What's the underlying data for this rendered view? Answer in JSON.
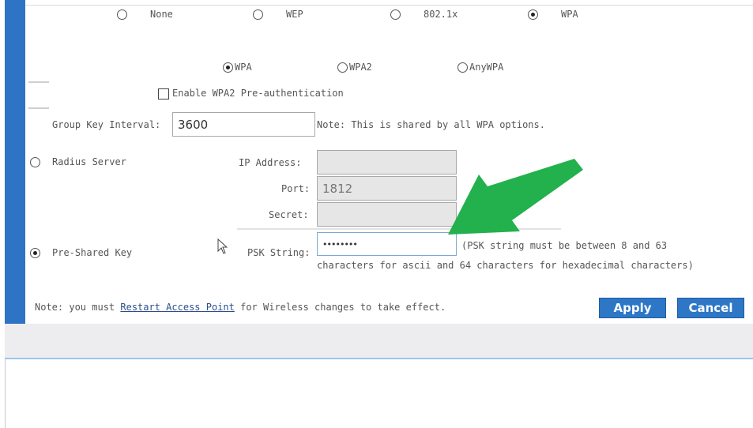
{
  "security_mode": {
    "options": [
      {
        "label": "None",
        "checked": false
      },
      {
        "label": "WEP",
        "checked": false
      },
      {
        "label": "802.1x",
        "checked": false
      },
      {
        "label": "WPA",
        "checked": true
      }
    ]
  },
  "wpa_version": {
    "options": [
      {
        "label": "WPA",
        "checked": true
      },
      {
        "label": "WPA2",
        "checked": false
      },
      {
        "label": "AnyWPA",
        "checked": false
      }
    ]
  },
  "preauth": {
    "label": "Enable WPA2 Pre-authentication",
    "checked": false
  },
  "group_key": {
    "label": "Group Key Interval:",
    "value": "3600",
    "note": "Note: This is shared by all WPA options."
  },
  "radius": {
    "label": "Radius Server",
    "checked": false,
    "ip_label": "IP Address:",
    "ip_value": "",
    "port_label": "Port:",
    "port_value": "1812",
    "secret_label": "Secret:",
    "secret_value": ""
  },
  "psk": {
    "label": "Pre-Shared Key",
    "checked": true,
    "string_label": "PSK String:",
    "string_value": "••••••••",
    "help_line1": "(PSK string must be between 8 and 63",
    "help_line2": "characters for ascii and 64 characters for hexadecimal characters)"
  },
  "footer": {
    "note_prefix": "Note: you must ",
    "link_text": "Restart Access Point",
    "note_suffix": " for Wireless changes to take effect.",
    "apply_label": "Apply",
    "cancel_label": "Cancel"
  },
  "colors": {
    "accent": "#2d74c4",
    "arrow": "#22b14c"
  }
}
